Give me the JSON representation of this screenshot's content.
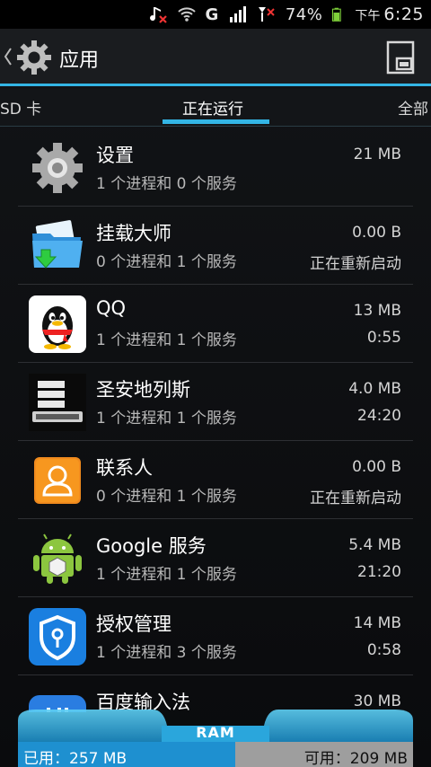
{
  "status_bar": {
    "battery_percent_text": "74%",
    "battery_level": 0.74,
    "time_period": "下午",
    "time": "6:25",
    "network_label": "G"
  },
  "header": {
    "title": "应用"
  },
  "tabs": [
    {
      "label": "SD 卡",
      "selected": false
    },
    {
      "label": "正在运行",
      "selected": true
    },
    {
      "label": "全部",
      "selected": false
    }
  ],
  "apps": [
    {
      "name": "设置",
      "desc": "1 个进程和 0 个服务",
      "size": "21 MB",
      "status": "",
      "icon": "settings-gear-icon"
    },
    {
      "name": "挂载大师",
      "desc": "0 个进程和 1 个服务",
      "size": "0.00 B",
      "status": "正在重新启动",
      "icon": "folder-download-icon"
    },
    {
      "name": "QQ",
      "desc": "1 个进程和 1 个服务",
      "size": "13 MB",
      "status": "0:55",
      "icon": "qq-penguin-icon"
    },
    {
      "name": "圣安地列斯",
      "desc": "1 个进程和 1 个服务",
      "size": "4.0 MB",
      "status": "24:20",
      "icon": "gta-san-andreas-icon"
    },
    {
      "name": "联系人",
      "desc": "0 个进程和 1 个服务",
      "size": "0.00 B",
      "status": "正在重新启动",
      "icon": "contacts-icon"
    },
    {
      "name": "Google 服务",
      "desc": "1 个进程和 1 个服务",
      "size": "5.4 MB",
      "status": "21:20",
      "icon": "android-robot-icon"
    },
    {
      "name": "授权管理",
      "desc": "1 个进程和 3 个服务",
      "size": "14 MB",
      "status": "0:58",
      "icon": "shield-key-icon"
    },
    {
      "name": "百度输入法",
      "desc": "",
      "size": "30 MB",
      "status": "",
      "icon": "baidu-input-icon"
    }
  ],
  "ram": {
    "label": "RAM",
    "used_text": "已用：257 MB",
    "free_text": "可用：209 MB",
    "used_fraction": 0.551
  },
  "colors": {
    "accent": "#33b5e5",
    "ram_used": "#1e90d0",
    "ram_free": "#9e9e9e"
  }
}
